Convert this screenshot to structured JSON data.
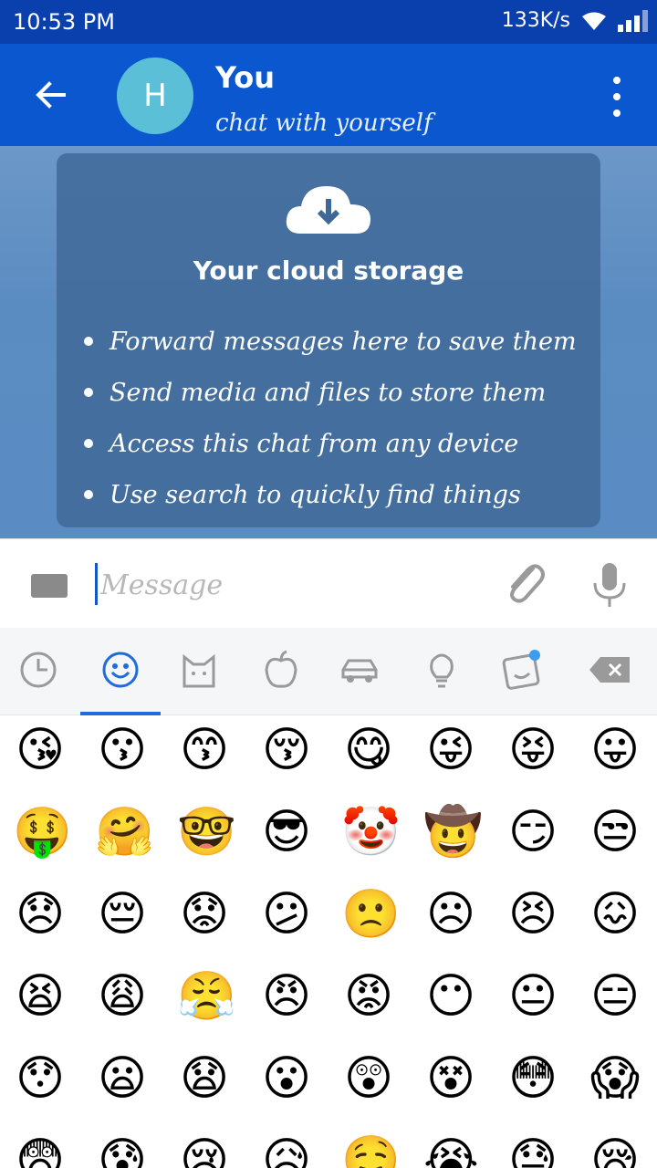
{
  "status": {
    "time": "10:53 PM",
    "speed": "133K/s"
  },
  "header": {
    "avatar_letter": "H",
    "title": "You",
    "subtitle": "chat with yourself"
  },
  "card": {
    "title": "Your cloud storage",
    "items": [
      "Forward messages here to save them",
      "Send media and files to store them",
      "Access this chat from any device",
      "Use search to quickly find things"
    ]
  },
  "input": {
    "placeholder": "Message",
    "value": ""
  },
  "emoji_tabs": [
    "recent-icon",
    "smileys-icon",
    "animals-icon",
    "food-icon",
    "travel-icon",
    "objects-icon",
    "stickers-icon",
    "backspace-icon"
  ],
  "emoji_rows": [
    [
      "😘",
      "😗",
      "😙",
      "😚",
      "😋",
      "😜",
      "😝",
      "😛"
    ],
    [
      "🤑",
      "🤗",
      "🤓",
      "😎",
      "🤡",
      "🤠",
      "😏",
      "😒"
    ],
    [
      "😞",
      "😔",
      "😟",
      "😕",
      "🙁",
      "☹",
      "😣",
      "😖"
    ],
    [
      "😫",
      "😩",
      "😤",
      "😠",
      "😡",
      "😶",
      "😐",
      "😑"
    ],
    [
      "😯",
      "😦",
      "😧",
      "😮",
      "😲",
      "😵",
      "😳",
      "😱"
    ],
    [
      "😨",
      "😰",
      "😢",
      "😥",
      "🤤",
      "😭",
      "😓",
      "😪"
    ]
  ],
  "colors": {
    "appbar": "#0b57d0",
    "statusbar": "#0a3fae",
    "accent": "#1e6bd9"
  }
}
